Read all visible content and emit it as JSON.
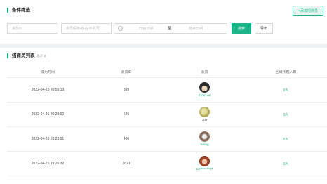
{
  "filter": {
    "title": "条件筛选",
    "add_button": "+添加招商员",
    "member_id_placeholder": "会员ID",
    "keyword_placeholder": "会员昵称/姓名/手机号",
    "start_date_placeholder": "开始日期",
    "date_separator": "至",
    "end_date_placeholder": "结束日期",
    "search_button": "搜索",
    "export_button": "导出"
  },
  "list": {
    "title": "招商员列表",
    "total": "总计:8",
    "columns": [
      "成为时间",
      "会员ID",
      "会员",
      "区域代理人数"
    ],
    "rows": [
      {
        "time": "2022-04-25 20:55:13",
        "id": "399",
        "name": "Eros1on",
        "agents": "0人",
        "avatar_color": "#3a3a3a"
      },
      {
        "time": "2022-04-25 20:29:00",
        "id": "646",
        "name": "Joy",
        "agents": "0人",
        "avatar_color": "#c9c46a"
      },
      {
        "time": "2022-04-25 20:23:51",
        "id": "406",
        "name": "Swag",
        "agents": "0人",
        "avatar_color": "#8a6f60"
      },
      {
        "time": "2022-04-25 19:26:32",
        "id": "1621",
        "name": "13*******77",
        "agents": "0人",
        "avatar_color": "#b04a2e"
      }
    ]
  },
  "colors": {
    "accent": "#1db489",
    "page_bg": "#eef2f5"
  }
}
